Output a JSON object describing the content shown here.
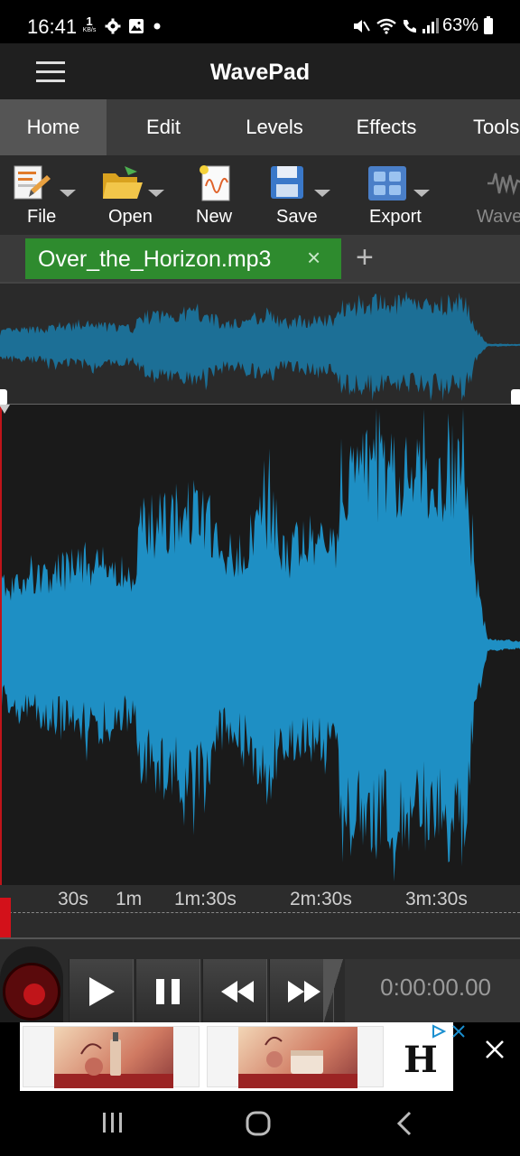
{
  "status_bar": {
    "time": "16:41",
    "data_rate_value": "1",
    "data_rate_unit": "KB/s",
    "battery": "63%"
  },
  "app": {
    "title": "WavePad"
  },
  "tabs": [
    {
      "label": "Home",
      "active": true
    },
    {
      "label": "Edit",
      "active": false
    },
    {
      "label": "Levels",
      "active": false
    },
    {
      "label": "Effects",
      "active": false
    },
    {
      "label": "Tools",
      "active": false
    }
  ],
  "toolbar": {
    "file": "File",
    "open": "Open",
    "new": "New",
    "save": "Save",
    "export": "Export",
    "wave": "Wave"
  },
  "file_tab": {
    "name": "Over_the_Horizon.mp3",
    "close": "×",
    "add": "+"
  },
  "timeline": {
    "labels": [
      "30s",
      "1m",
      "1m:30s",
      "2m:30s",
      "3m:30s"
    ]
  },
  "transport": {
    "time": "0:00:00.00"
  },
  "ad": {
    "logo": "H"
  },
  "colors": {
    "waveform": "#1e8fc4",
    "overview_wave": "#1c6f96",
    "file_tab": "#2e8b2e",
    "record": "#c0151a"
  }
}
